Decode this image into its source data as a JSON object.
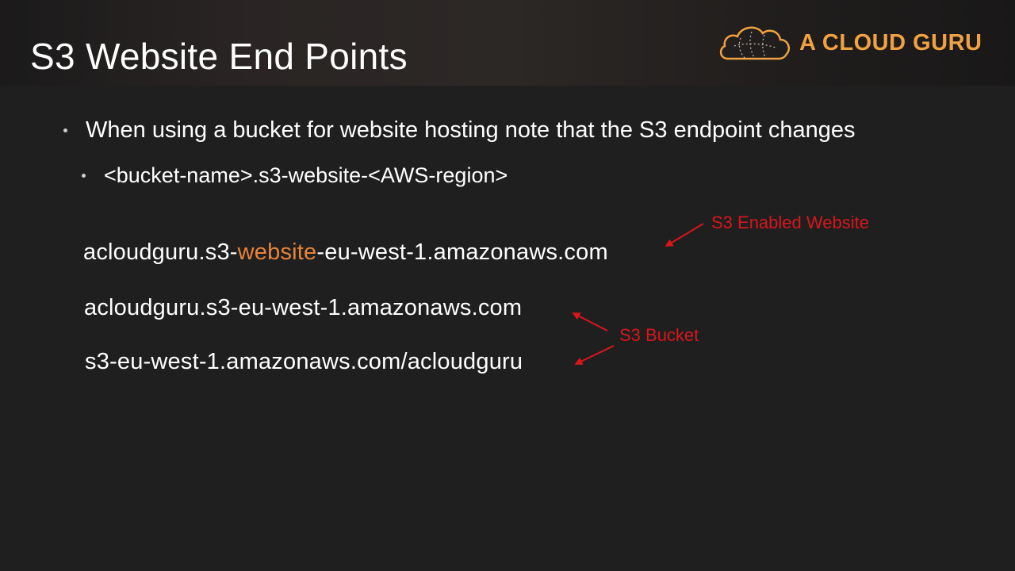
{
  "slide": {
    "title": "S3 Website End Points",
    "logo": {
      "text": "A CLOUD GURU",
      "icon": "cloud-icon"
    },
    "bullets": [
      "When using a bucket for website hosting note that the S3 endpoint changes",
      "<bucket-name>.s3-website-<AWS-region>"
    ],
    "urls": {
      "website": {
        "prefix": "acloudguru.s3-",
        "highlight": "website",
        "suffix": "-eu-west-1.amazonaws.com"
      },
      "bucket_subdomain": "acloudguru.s3-eu-west-1.amazonaws.com",
      "bucket_path": "s3-eu-west-1.amazonaws.com/acloudguru"
    },
    "annotations": {
      "website": "S3 Enabled Website",
      "bucket": "S3 Bucket"
    },
    "colors": {
      "highlight": "#e8843a",
      "annotation": "#d9161c",
      "brand": "#f1a141"
    }
  }
}
